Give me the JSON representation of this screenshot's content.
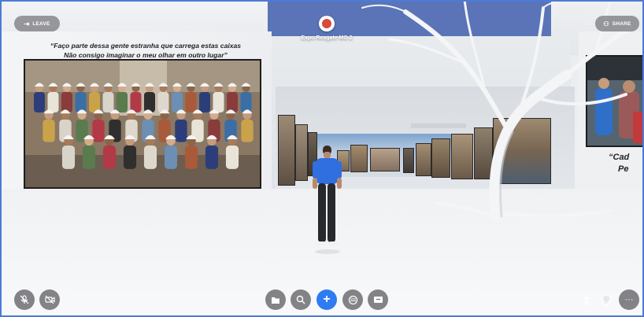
{
  "header": {
    "leave_label": "LEAVE",
    "share_label": "SHARE",
    "venue_name": "Expo Resgate MG 2"
  },
  "gallery": {
    "quote_left_line1": "“Faço parte dessa gente estranha que carrega estas caixas",
    "quote_left_line2": "Não consigo imaginar o meu olhar em outro lugar”",
    "quote_right_line1": "“Cad",
    "quote_right_line2": "Pe"
  },
  "toolbar": {
    "left_buttons": [
      "mic-off-icon",
      "camera-off-icon"
    ],
    "center_buttons": [
      "folder-icon",
      "search-icon",
      "plus-icon",
      "emoji-icon",
      "screen-share-icon"
    ],
    "right_buttons": [
      "accessibility-icon",
      "help-icon",
      "more-icon"
    ]
  },
  "colors": {
    "accent": "#2f7bf2",
    "sky": "#5b74b8",
    "avatar_shirt": "#2f6fe0"
  }
}
